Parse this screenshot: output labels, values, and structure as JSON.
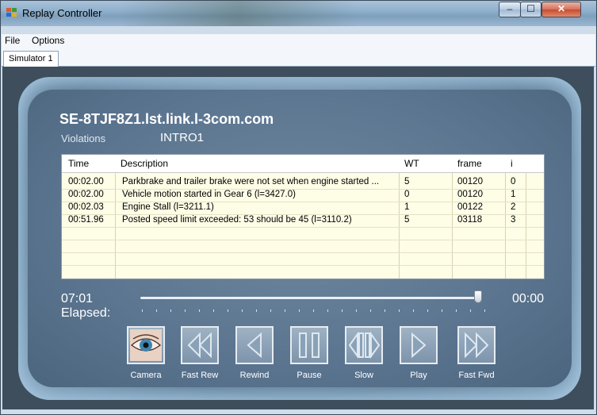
{
  "window": {
    "title": "Replay Controller"
  },
  "window_buttons": {
    "minimize": "–",
    "maximize": "☐",
    "close": "✕"
  },
  "menu": [
    "File",
    "Options"
  ],
  "tabs": [
    "Simulator 1"
  ],
  "session": {
    "host": "SE-8TJF8Z1.lst.link.l-3com.com",
    "violations_label": "Violations",
    "violations_value": "INTRO1"
  },
  "table": {
    "columns": [
      "Time",
      "Description",
      "WT",
      "frame",
      "i"
    ],
    "rows": [
      [
        "00:02.00",
        "Parkbrake and trailer brake were not set when engine started  ...",
        "5",
        "00120",
        "0"
      ],
      [
        "00:02.00",
        "Vehicle motion started in Gear 6  (l=3427.0)",
        "0",
        "00120",
        "1"
      ],
      [
        "00:02.03",
        "Engine Stall  (l=3211.1)",
        "1",
        "00122",
        "2"
      ],
      [
        "00:51.96",
        "Posted speed limit exceeded: 53 should be 45  (l=3110.2)",
        "5",
        "03118",
        "3"
      ]
    ]
  },
  "playback": {
    "elapsed_time": "07:01",
    "elapsed_label": "Elapsed:",
    "remaining_time": "00:00",
    "slider_position": 1.0
  },
  "controls": [
    {
      "label": "Camera",
      "icon": "eye-icon"
    },
    {
      "label": "Fast Rew",
      "icon": "fast-rewind-icon"
    },
    {
      "label": "Rewind",
      "icon": "rewind-icon"
    },
    {
      "label": "Pause",
      "icon": "pause-icon"
    },
    {
      "label": "Slow",
      "icon": "slow-icon"
    },
    {
      "label": "Play",
      "icon": "play-icon"
    },
    {
      "label": "Fast Fwd",
      "icon": "fast-forward-icon"
    }
  ]
}
